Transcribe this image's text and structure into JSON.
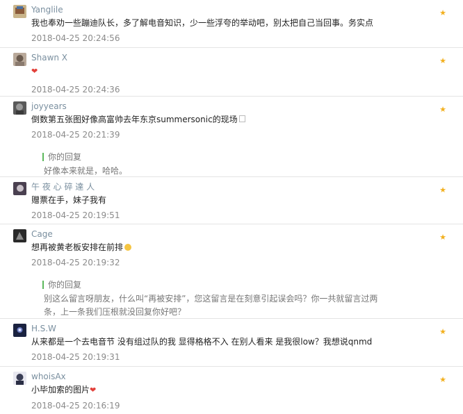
{
  "comments": [
    {
      "username": "Yanglile",
      "text": "我也奉劝一些蹦迪队长，多了解电音知识，少一些浮夸的举动吧，别太把自己当回事。务实点",
      "time": "2018-04-25 20:24:56"
    },
    {
      "username": "Shawn X",
      "text_emoji": "heart-emoji",
      "time": "2018-04-25 20:24:36"
    },
    {
      "username": "joyyears",
      "text": "倒数第五张图好像高富帅去年东京summersonic的现场",
      "time": "2018-04-25 20:21:39",
      "reply": {
        "label": "你的回复",
        "text": "好像本来就是，哈哈。"
      }
    },
    {
      "username": "午 夜 心 碎 達 人",
      "text": "赠票在手，妹子我有",
      "time": "2018-04-25 20:19:51"
    },
    {
      "username": "Cage",
      "text": "想再被黄老板安排在前排",
      "time": "2018-04-25 20:19:32",
      "reply": {
        "label": "你的回复",
        "text": "别这么留言呀朋友，什么叫“再被安排”，您这留言是在刻意引起误会吗？你一共就留言过两条，上一条我们压根就没回复你好吧？"
      }
    },
    {
      "username": "H.S.W",
      "text": "从来都是一个去电音节 没有组过队的我 显得格格不入 在别人看来 是我很low？我想说qnmd",
      "time": "2018-04-25 20:19:31"
    },
    {
      "username": "whoisAx",
      "text": "小毕加索的图片",
      "time": "2018-04-25 20:16:19"
    }
  ],
  "icons": {
    "star": "star-icon",
    "avatar": "avatar-image"
  },
  "colors": {
    "star": "#f2b01e",
    "username": "#7a8f9f",
    "reply_bar": "#5cb85c"
  }
}
